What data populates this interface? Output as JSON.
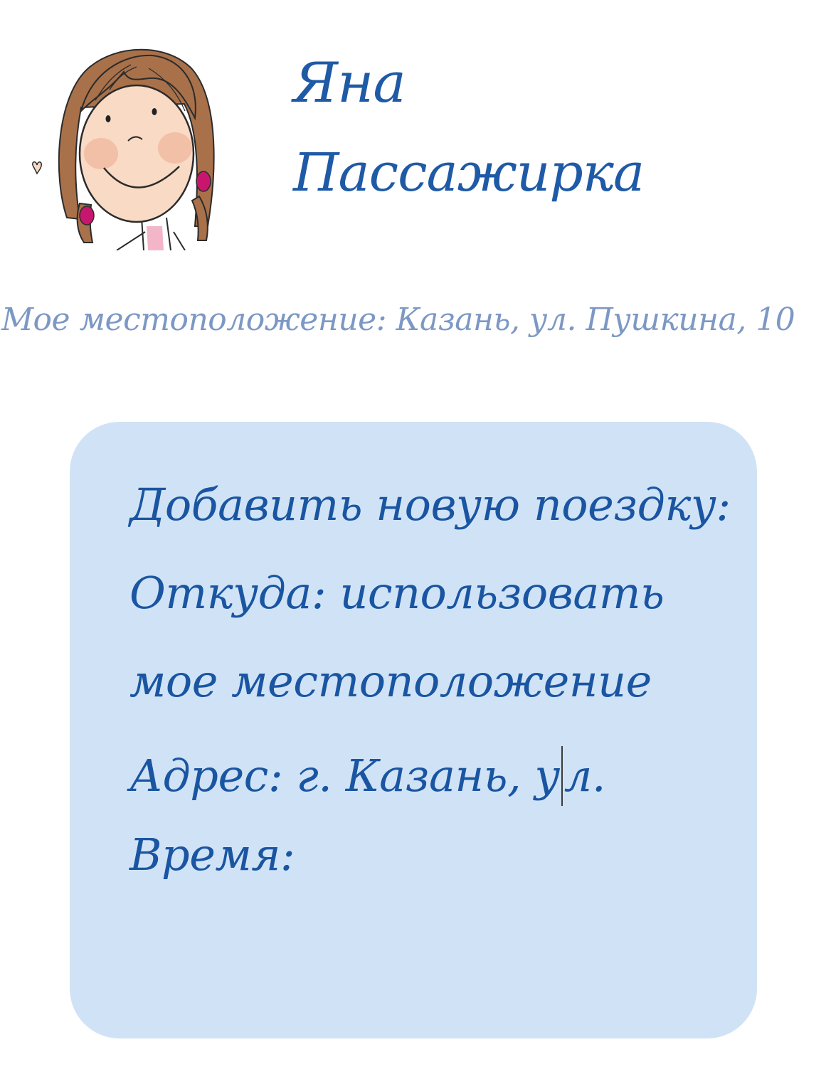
{
  "profile": {
    "first_name": "Яна",
    "role": "Пассажирка"
  },
  "location": {
    "text": "Мое местоположение: Казань, ул. Пушкина, 10"
  },
  "trip_form": {
    "title": "Добавить новую поездку:",
    "from_label": "Откуда: использовать",
    "use_location_text": "мое местоположение",
    "address_text_before_caret": "Адрес: г. Казань, у",
    "address_text_after_caret": "л.",
    "time_label": "Время:"
  },
  "colors": {
    "text_primary": "#1a55a2",
    "text_location": "#7c98c4",
    "card_background": "#d0e3f6"
  }
}
